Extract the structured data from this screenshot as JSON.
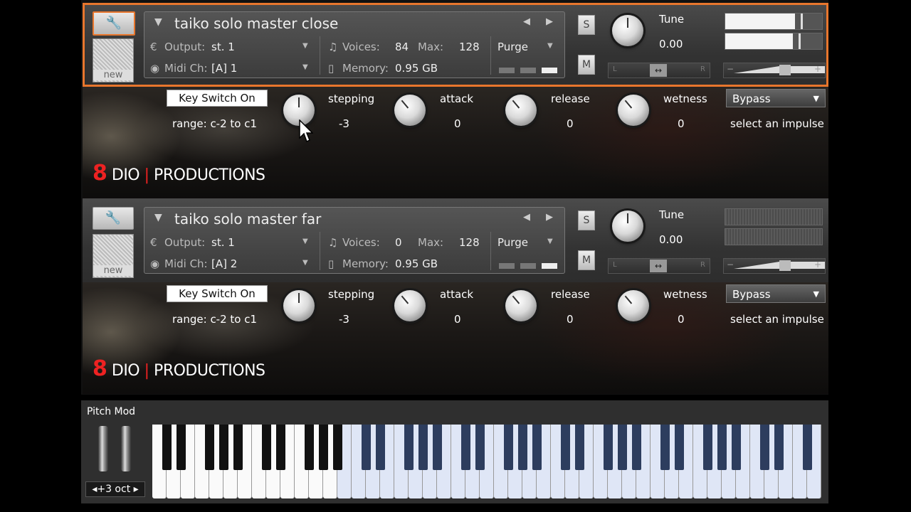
{
  "instruments": [
    {
      "name": "taiko solo master close",
      "output_label": "Output:",
      "output_value": "st. 1",
      "midi_label": "Midi Ch:",
      "midi_value": "[A]  1",
      "voices_label": "Voices:",
      "voices_value": "84",
      "max_label": "Max:",
      "max_value": "128",
      "purge_label": "Purge",
      "memory_label": "Memory:",
      "memory_value": "0.95 GB",
      "solo_label": "S",
      "mute_label": "M",
      "tune_label": "Tune",
      "tune_value": "0.00",
      "new_label": "new",
      "key_switch_label": "Key Switch On",
      "range_label": "range: c-2 to c1",
      "stepping_label": "stepping",
      "stepping_value": "-3",
      "attack_label": "attack",
      "attack_value": "0",
      "release_label": "release",
      "release_value": "0",
      "wetness_label": "wetness",
      "wetness_value": "0",
      "bypass_label": "Bypass",
      "impulse_label": "select an impulse",
      "logo_text": "DIO",
      "logo_brand": "PRODUCTIONS",
      "meter_level": 0.72,
      "selected": true
    },
    {
      "name": "taiko solo master far",
      "output_label": "Output:",
      "output_value": "st. 1",
      "midi_label": "Midi Ch:",
      "midi_value": "[A]  2",
      "voices_label": "Voices:",
      "voices_value": "0",
      "max_label": "Max:",
      "max_value": "128",
      "purge_label": "Purge",
      "memory_label": "Memory:",
      "memory_value": "0.95 GB",
      "solo_label": "S",
      "mute_label": "M",
      "tune_label": "Tune",
      "tune_value": "0.00",
      "new_label": "new",
      "key_switch_label": "Key Switch On",
      "range_label": "range: c-2 to c1",
      "stepping_label": "stepping",
      "stepping_value": "-3",
      "attack_label": "attack",
      "attack_value": "0",
      "release_label": "release",
      "release_value": "0",
      "wetness_label": "wetness",
      "wetness_value": "0",
      "bypass_label": "Bypass",
      "impulse_label": "select an impulse",
      "logo_text": "DIO",
      "logo_brand": "PRODUCTIONS",
      "meter_level": 0,
      "selected": false
    }
  ],
  "keyboard": {
    "pitch_mod_label": "Pitch Mod",
    "octave_label": "◂+3 oct ▸"
  },
  "colors": {
    "selection": "#e8762d",
    "logo_red": "#e22222",
    "key_highlight": "#dfe6f6"
  }
}
